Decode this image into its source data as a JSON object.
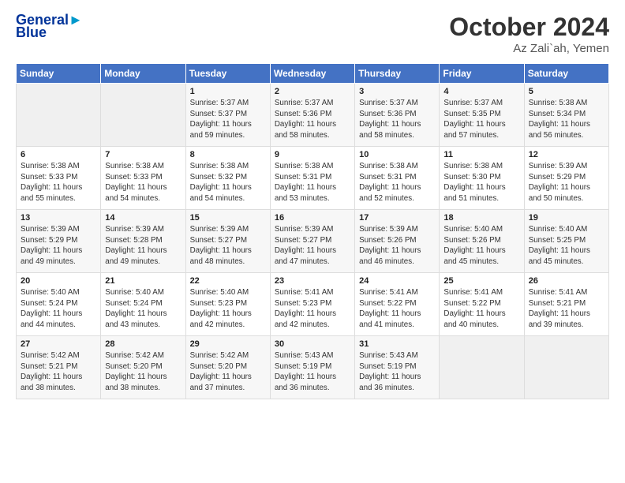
{
  "header": {
    "logo_line1": "General",
    "logo_line2": "Blue",
    "month": "October 2024",
    "location": "Az Zali`ah, Yemen"
  },
  "weekdays": [
    "Sunday",
    "Monday",
    "Tuesday",
    "Wednesday",
    "Thursday",
    "Friday",
    "Saturday"
  ],
  "weeks": [
    [
      {
        "day": "",
        "sunrise": "",
        "sunset": "",
        "daylight": ""
      },
      {
        "day": "",
        "sunrise": "",
        "sunset": "",
        "daylight": ""
      },
      {
        "day": "1",
        "sunrise": "Sunrise: 5:37 AM",
        "sunset": "Sunset: 5:37 PM",
        "daylight": "Daylight: 11 hours and 59 minutes."
      },
      {
        "day": "2",
        "sunrise": "Sunrise: 5:37 AM",
        "sunset": "Sunset: 5:36 PM",
        "daylight": "Daylight: 11 hours and 58 minutes."
      },
      {
        "day": "3",
        "sunrise": "Sunrise: 5:37 AM",
        "sunset": "Sunset: 5:36 PM",
        "daylight": "Daylight: 11 hours and 58 minutes."
      },
      {
        "day": "4",
        "sunrise": "Sunrise: 5:37 AM",
        "sunset": "Sunset: 5:35 PM",
        "daylight": "Daylight: 11 hours and 57 minutes."
      },
      {
        "day": "5",
        "sunrise": "Sunrise: 5:38 AM",
        "sunset": "Sunset: 5:34 PM",
        "daylight": "Daylight: 11 hours and 56 minutes."
      }
    ],
    [
      {
        "day": "6",
        "sunrise": "Sunrise: 5:38 AM",
        "sunset": "Sunset: 5:33 PM",
        "daylight": "Daylight: 11 hours and 55 minutes."
      },
      {
        "day": "7",
        "sunrise": "Sunrise: 5:38 AM",
        "sunset": "Sunset: 5:33 PM",
        "daylight": "Daylight: 11 hours and 54 minutes."
      },
      {
        "day": "8",
        "sunrise": "Sunrise: 5:38 AM",
        "sunset": "Sunset: 5:32 PM",
        "daylight": "Daylight: 11 hours and 54 minutes."
      },
      {
        "day": "9",
        "sunrise": "Sunrise: 5:38 AM",
        "sunset": "Sunset: 5:31 PM",
        "daylight": "Daylight: 11 hours and 53 minutes."
      },
      {
        "day": "10",
        "sunrise": "Sunrise: 5:38 AM",
        "sunset": "Sunset: 5:31 PM",
        "daylight": "Daylight: 11 hours and 52 minutes."
      },
      {
        "day": "11",
        "sunrise": "Sunrise: 5:38 AM",
        "sunset": "Sunset: 5:30 PM",
        "daylight": "Daylight: 11 hours and 51 minutes."
      },
      {
        "day": "12",
        "sunrise": "Sunrise: 5:39 AM",
        "sunset": "Sunset: 5:29 PM",
        "daylight": "Daylight: 11 hours and 50 minutes."
      }
    ],
    [
      {
        "day": "13",
        "sunrise": "Sunrise: 5:39 AM",
        "sunset": "Sunset: 5:29 PM",
        "daylight": "Daylight: 11 hours and 49 minutes."
      },
      {
        "day": "14",
        "sunrise": "Sunrise: 5:39 AM",
        "sunset": "Sunset: 5:28 PM",
        "daylight": "Daylight: 11 hours and 49 minutes."
      },
      {
        "day": "15",
        "sunrise": "Sunrise: 5:39 AM",
        "sunset": "Sunset: 5:27 PM",
        "daylight": "Daylight: 11 hours and 48 minutes."
      },
      {
        "day": "16",
        "sunrise": "Sunrise: 5:39 AM",
        "sunset": "Sunset: 5:27 PM",
        "daylight": "Daylight: 11 hours and 47 minutes."
      },
      {
        "day": "17",
        "sunrise": "Sunrise: 5:39 AM",
        "sunset": "Sunset: 5:26 PM",
        "daylight": "Daylight: 11 hours and 46 minutes."
      },
      {
        "day": "18",
        "sunrise": "Sunrise: 5:40 AM",
        "sunset": "Sunset: 5:26 PM",
        "daylight": "Daylight: 11 hours and 45 minutes."
      },
      {
        "day": "19",
        "sunrise": "Sunrise: 5:40 AM",
        "sunset": "Sunset: 5:25 PM",
        "daylight": "Daylight: 11 hours and 45 minutes."
      }
    ],
    [
      {
        "day": "20",
        "sunrise": "Sunrise: 5:40 AM",
        "sunset": "Sunset: 5:24 PM",
        "daylight": "Daylight: 11 hours and 44 minutes."
      },
      {
        "day": "21",
        "sunrise": "Sunrise: 5:40 AM",
        "sunset": "Sunset: 5:24 PM",
        "daylight": "Daylight: 11 hours and 43 minutes."
      },
      {
        "day": "22",
        "sunrise": "Sunrise: 5:40 AM",
        "sunset": "Sunset: 5:23 PM",
        "daylight": "Daylight: 11 hours and 42 minutes."
      },
      {
        "day": "23",
        "sunrise": "Sunrise: 5:41 AM",
        "sunset": "Sunset: 5:23 PM",
        "daylight": "Daylight: 11 hours and 42 minutes."
      },
      {
        "day": "24",
        "sunrise": "Sunrise: 5:41 AM",
        "sunset": "Sunset: 5:22 PM",
        "daylight": "Daylight: 11 hours and 41 minutes."
      },
      {
        "day": "25",
        "sunrise": "Sunrise: 5:41 AM",
        "sunset": "Sunset: 5:22 PM",
        "daylight": "Daylight: 11 hours and 40 minutes."
      },
      {
        "day": "26",
        "sunrise": "Sunrise: 5:41 AM",
        "sunset": "Sunset: 5:21 PM",
        "daylight": "Daylight: 11 hours and 39 minutes."
      }
    ],
    [
      {
        "day": "27",
        "sunrise": "Sunrise: 5:42 AM",
        "sunset": "Sunset: 5:21 PM",
        "daylight": "Daylight: 11 hours and 38 minutes."
      },
      {
        "day": "28",
        "sunrise": "Sunrise: 5:42 AM",
        "sunset": "Sunset: 5:20 PM",
        "daylight": "Daylight: 11 hours and 38 minutes."
      },
      {
        "day": "29",
        "sunrise": "Sunrise: 5:42 AM",
        "sunset": "Sunset: 5:20 PM",
        "daylight": "Daylight: 11 hours and 37 minutes."
      },
      {
        "day": "30",
        "sunrise": "Sunrise: 5:43 AM",
        "sunset": "Sunset: 5:19 PM",
        "daylight": "Daylight: 11 hours and 36 minutes."
      },
      {
        "day": "31",
        "sunrise": "Sunrise: 5:43 AM",
        "sunset": "Sunset: 5:19 PM",
        "daylight": "Daylight: 11 hours and 36 minutes."
      },
      {
        "day": "",
        "sunrise": "",
        "sunset": "",
        "daylight": ""
      },
      {
        "day": "",
        "sunrise": "",
        "sunset": "",
        "daylight": ""
      }
    ]
  ]
}
